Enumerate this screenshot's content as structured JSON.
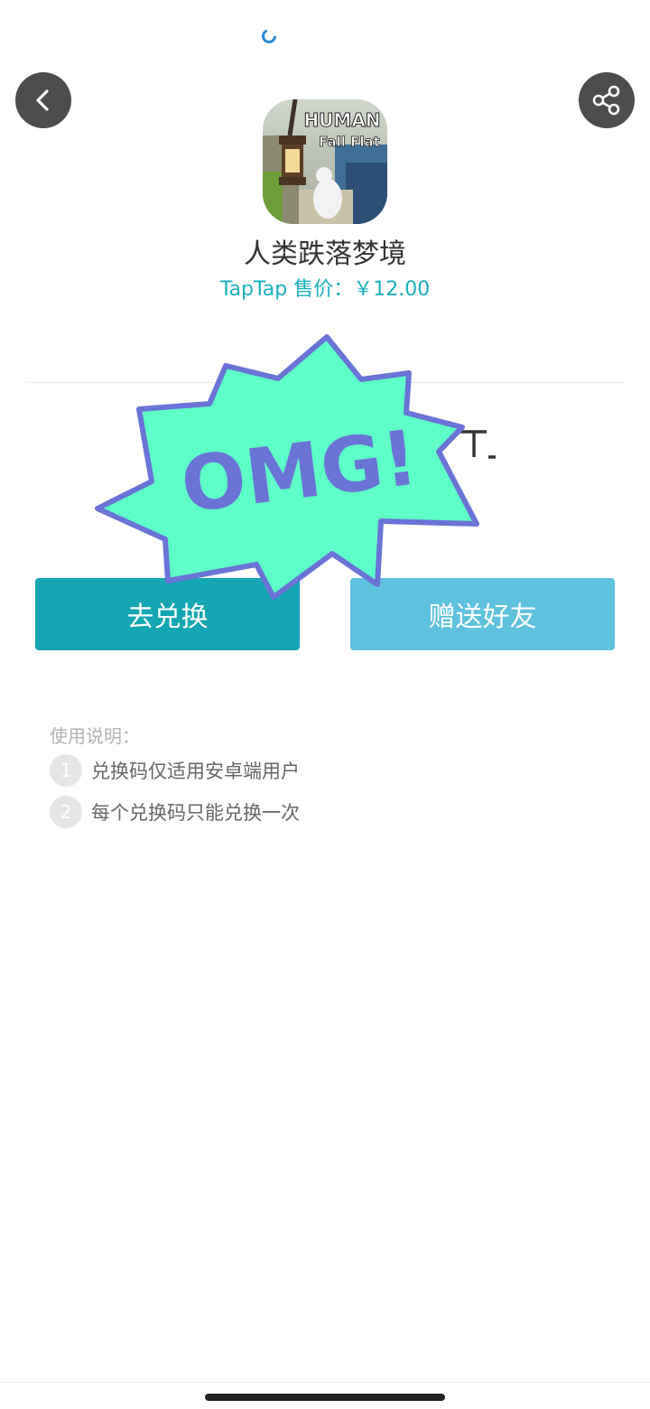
{
  "header": {
    "back_icon": "chevron-left-icon",
    "share_icon": "share-icon",
    "loading_icon": "loading-spinner-icon"
  },
  "app": {
    "icon_text_line1": "HUMAN",
    "icon_text_line2": "Fall Flat",
    "title": "人类跌落梦境",
    "price": "TapTap 售价：￥12.00"
  },
  "sticker": {
    "text": "OMG!"
  },
  "buttons": {
    "redeem_label": "去兑换",
    "gift_label": "赠送好友"
  },
  "instructions": {
    "title": "使用说明：",
    "items": [
      {
        "num": "1",
        "text": "兑换码仅适用安卓端用户"
      },
      {
        "num": "2",
        "text": "每个兑换码只能兑换一次"
      }
    ]
  },
  "colors": {
    "accent_teal": "#1ab0bd",
    "redeem_button": "#14a6b3",
    "gift_button": "#5ec1de",
    "sticker_fill": "#5fffc9",
    "sticker_stroke": "#6b73d6"
  }
}
